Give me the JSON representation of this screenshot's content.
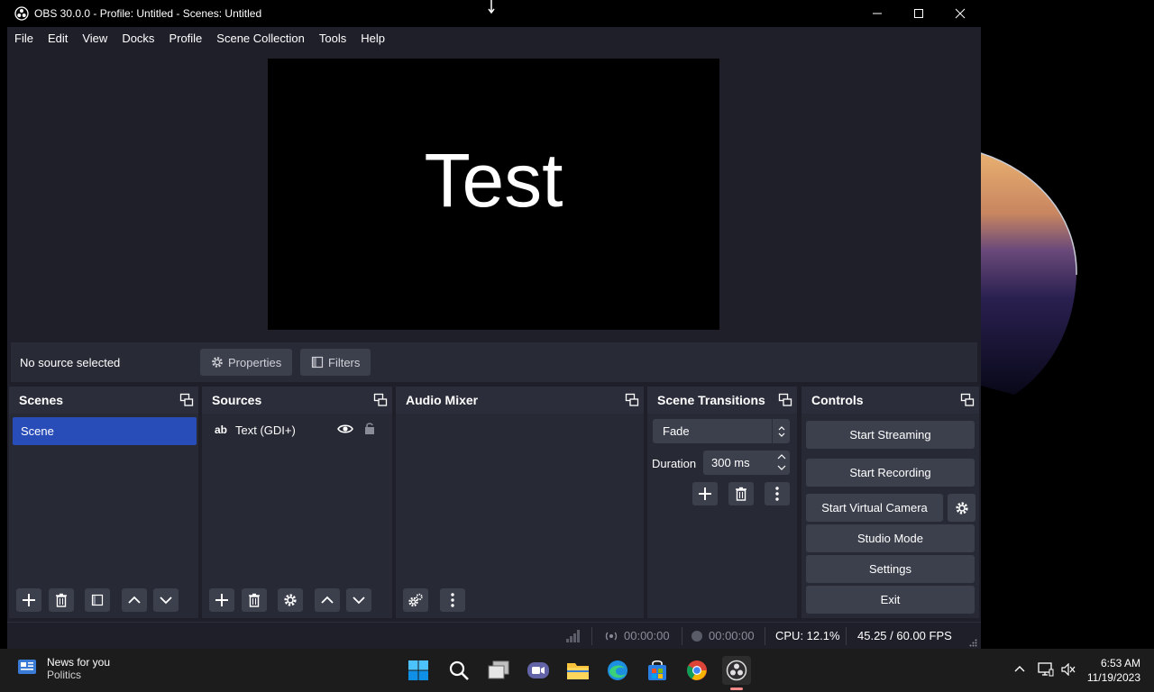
{
  "window": {
    "title": "OBS 30.0.0 - Profile: Untitled - Scenes: Untitled"
  },
  "menu": [
    "File",
    "Edit",
    "View",
    "Docks",
    "Profile",
    "Scene Collection",
    "Tools",
    "Help"
  ],
  "preview": {
    "text": "Test"
  },
  "source_toolbar": {
    "status": "No source selected",
    "properties_label": "Properties",
    "filters_label": "Filters"
  },
  "docks": {
    "scenes": {
      "title": "Scenes",
      "items": [
        "Scene"
      ]
    },
    "sources": {
      "title": "Sources",
      "items": [
        {
          "icon": "ab",
          "label": "Text (GDI+)"
        }
      ]
    },
    "audio_mixer": {
      "title": "Audio Mixer"
    },
    "scene_transitions": {
      "title": "Scene Transitions",
      "transition": "Fade",
      "duration_label": "Duration",
      "duration_value": "300 ms"
    },
    "controls": {
      "title": "Controls",
      "start_streaming": "Start Streaming",
      "start_recording": "Start Recording",
      "start_virtual_camera": "Start Virtual Camera",
      "studio_mode": "Studio Mode",
      "settings": "Settings",
      "exit": "Exit"
    }
  },
  "status_bar": {
    "stream_time": "00:00:00",
    "record_time": "00:00:00",
    "cpu": "CPU: 12.1%",
    "fps": "45.25 / 60.00 FPS"
  },
  "taskbar": {
    "news_title": "News for you",
    "news_subtitle": "Politics",
    "time": "6:53 AM",
    "date": "11/19/2023"
  },
  "colors": {
    "accent": "#284cb8",
    "panel": "#272935",
    "button": "#3c404d",
    "background": "#1e1f29"
  }
}
